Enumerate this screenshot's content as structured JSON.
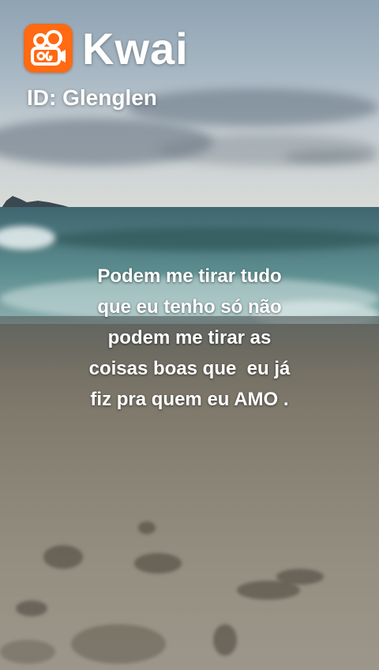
{
  "watermark": {
    "brand": "Kwai",
    "user_id": "ID: Glenglen",
    "logo_icon": "kwai-logo-icon",
    "accent_color": "#ff6a13"
  },
  "caption": {
    "lines": [
      "Podem me tirar tudo",
      "que eu tenho só não",
      "podem me tirar as",
      "coisas boas que  eu já",
      "fiz pra quem eu AMO ."
    ]
  },
  "background": {
    "scene": "beach-video-frame"
  }
}
